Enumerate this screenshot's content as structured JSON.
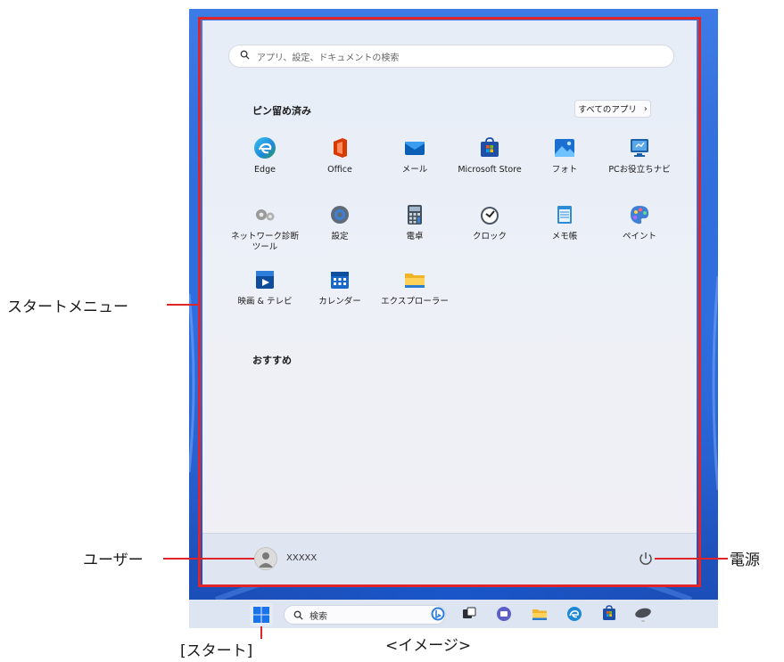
{
  "start_menu": {
    "search_placeholder": "アプリ、設定、ドキュメントの検索",
    "pinned_title": "ピン留め済み",
    "all_apps_label": "すべてのアプリ",
    "all_apps_chevron": "›",
    "recommended_title": "おすすめ",
    "apps": [
      {
        "label": "Edge",
        "icon": "edge-icon"
      },
      {
        "label": "Office",
        "icon": "office-icon"
      },
      {
        "label": "メール",
        "icon": "mail-icon"
      },
      {
        "label": "Microsoft Store",
        "icon": "store-icon"
      },
      {
        "label": "フォト",
        "icon": "photos-icon"
      },
      {
        "label": "PCお役立ちナビ",
        "icon": "pc-navi-icon"
      },
      {
        "label": "ネットワーク診断ツール",
        "icon": "network-diagnostic-icon"
      },
      {
        "label": "設定",
        "icon": "settings-icon"
      },
      {
        "label": "電卓",
        "icon": "calculator-icon"
      },
      {
        "label": "クロック",
        "icon": "clock-icon"
      },
      {
        "label": "メモ帳",
        "icon": "notepad-icon"
      },
      {
        "label": "ペイント",
        "icon": "paint-icon"
      },
      {
        "label": "映画 & テレビ",
        "icon": "movies-tv-icon"
      },
      {
        "label": "カレンダー",
        "icon": "calendar-icon"
      },
      {
        "label": "エクスプローラー",
        "icon": "file-explorer-icon"
      }
    ],
    "user_name": "XXXXX"
  },
  "taskbar": {
    "search_label": "検索",
    "items": [
      "bing-icon",
      "task-view-icon",
      "teams-chat-icon",
      "file-explorer-icon",
      "edge-icon",
      "store-icon",
      "mouse-icon"
    ]
  },
  "callouts": {
    "start_menu": "スタートメニュー",
    "user": "ユーザー",
    "power": "電源",
    "start_button": "[スタート]",
    "image_caption": "<イメージ>"
  }
}
